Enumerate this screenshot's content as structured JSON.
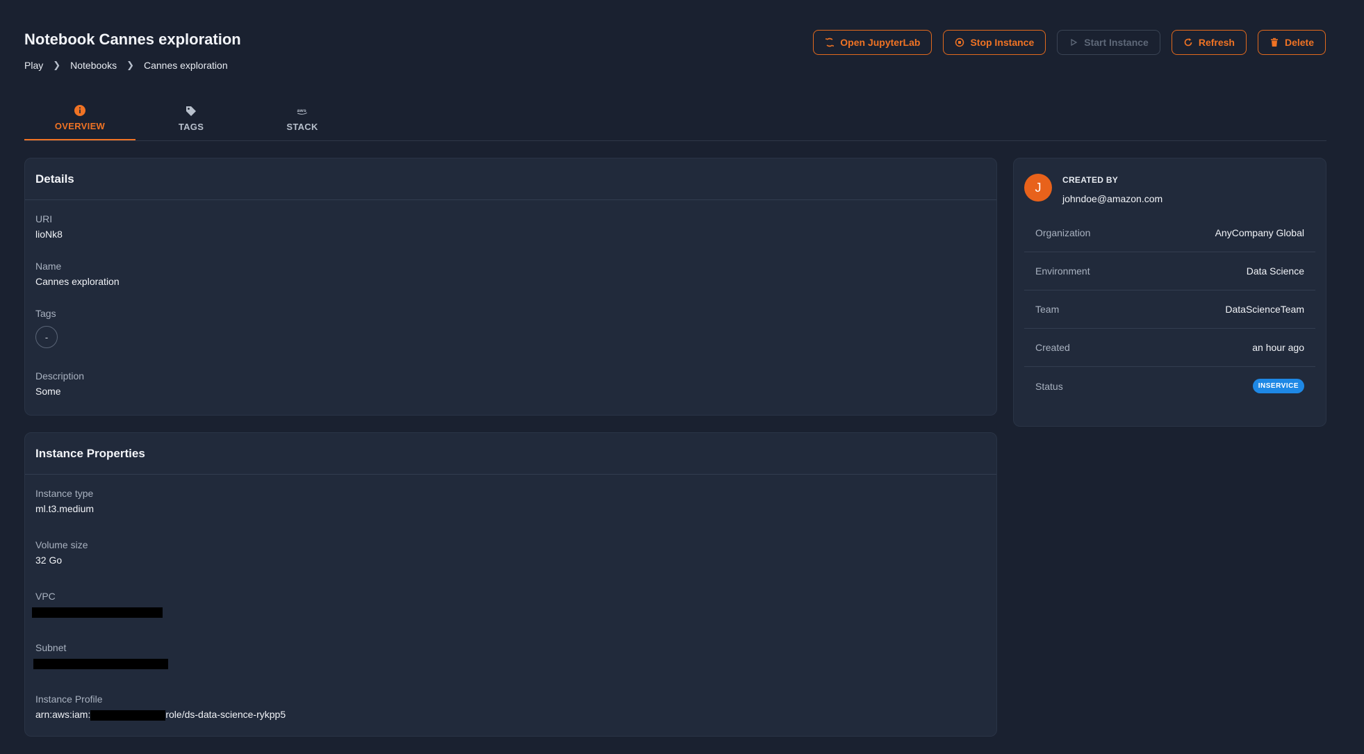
{
  "header": {
    "title": "Notebook Cannes exploration",
    "breadcrumb": [
      "Play",
      "Notebooks",
      "Cannes exploration"
    ]
  },
  "actions": {
    "open_jupyter": "Open JupyterLab",
    "stop_instance": "Stop Instance",
    "start_instance": "Start Instance",
    "refresh": "Refresh",
    "delete": "Delete"
  },
  "tabs": [
    {
      "label": "OVERVIEW",
      "icon": "info-icon",
      "active": true
    },
    {
      "label": "TAGS",
      "icon": "tag-icon",
      "active": false
    },
    {
      "label": "STACK",
      "icon": "aws-icon",
      "active": false
    }
  ],
  "details": {
    "title": "Details",
    "uri_label": "URI",
    "uri": "lioNk8",
    "name_label": "Name",
    "name": "Cannes exploration",
    "tags_label": "Tags",
    "tags_value": "-",
    "description_label": "Description",
    "description": "Some"
  },
  "instance": {
    "title": "Instance Properties",
    "type_label": "Instance type",
    "type": "ml.t3.medium",
    "volume_label": "Volume size",
    "volume": "32 Go",
    "vpc_label": "VPC",
    "subnet_label": "Subnet",
    "profile_label": "Instance Profile",
    "profile_prefix": "arn:aws:iam:",
    "profile_suffix": "role/ds-data-science-rykpp5"
  },
  "creator": {
    "initial": "J",
    "label": "CREATED BY",
    "email": "johndoe@amazon.com"
  },
  "meta": [
    {
      "key": "Organization",
      "value": "AnyCompany Global"
    },
    {
      "key": "Environment",
      "value": "Data Science"
    },
    {
      "key": "Team",
      "value": "DataScienceTeam"
    },
    {
      "key": "Created",
      "value": "an hour ago"
    },
    {
      "key": "Status",
      "value": "INSERVICE"
    }
  ],
  "colors": {
    "accent": "#f07324",
    "background": "#1a2130",
    "card": "#212a3b",
    "status": "#1e88e5"
  }
}
